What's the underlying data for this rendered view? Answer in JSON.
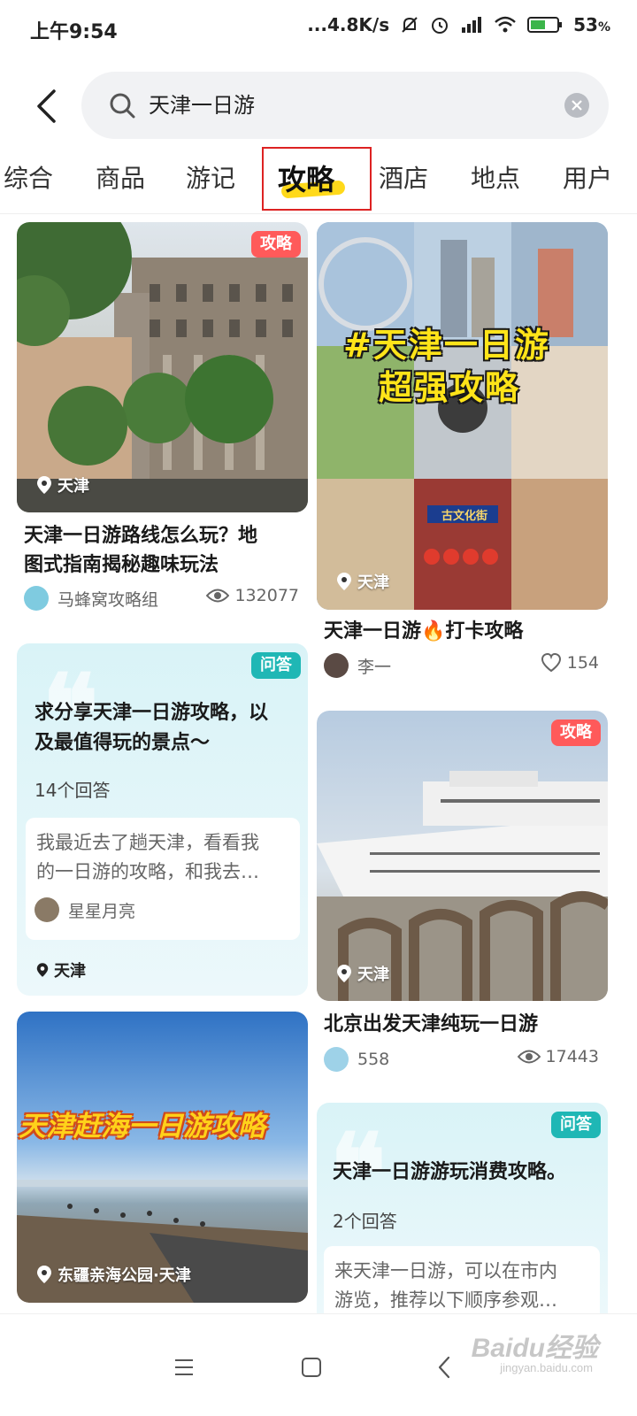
{
  "status_bar": {
    "time": "上午9:54",
    "net_speed": "...4.8K/s",
    "battery": "53",
    "battery_unit": "%"
  },
  "search": {
    "query": "天津一日游"
  },
  "tabs": [
    {
      "label": "综合"
    },
    {
      "label": "商品"
    },
    {
      "label": "游记"
    },
    {
      "label": "攻略",
      "active": true
    },
    {
      "label": "酒店"
    },
    {
      "label": "地点"
    },
    {
      "label": "用户"
    }
  ],
  "cards": {
    "card1": {
      "badge": "攻略",
      "location": "天津",
      "title_line1": "天津一日游路线怎么玩？地",
      "title_line2": "图式指南揭秘趣味玩法",
      "author": "马蜂窝攻略组",
      "views": "132077"
    },
    "card2": {
      "overlay_line1": "#天津一日游",
      "overlay_line2": "超强攻略",
      "sign_text": "古文化街",
      "location": "天津",
      "title": "天津一日游🔥打卡攻略",
      "author": "李一",
      "likes": "154"
    },
    "qa1": {
      "badge": "问答",
      "title_line1": "求分享天津一日游攻略，以",
      "title_line2": "及最值得玩的景点～",
      "answers": "14个回答",
      "answer_line1": "我最近去了趟天津，看看我",
      "answer_line2": "的一日游的攻略，和我去…",
      "answer_user": "星星月亮",
      "location": "天津"
    },
    "card3": {
      "badge": "攻略",
      "location": "天津",
      "title": "北京出发天津纯玩一日游",
      "author": "558",
      "views": "17443"
    },
    "card4": {
      "overlay": "天津赶海一日游攻略",
      "location": "东疆亲海公园·天津"
    },
    "qa2": {
      "badge": "问答",
      "title": "天津一日游游玩消费攻略。",
      "answers": "2个回答",
      "answer_line1": "来天津一日游，可以在市内",
      "answer_line2": "游览，推荐以下顺序参观…"
    }
  },
  "watermark": {
    "main": "Baidu经验",
    "sub": "jingyan.baidu.com"
  },
  "colors": {
    "accent_yellow": "#ffd91a",
    "badge_red": "#ff5a5a",
    "badge_teal": "#1fb7b5",
    "qa_bg": "#d9f3f7"
  }
}
